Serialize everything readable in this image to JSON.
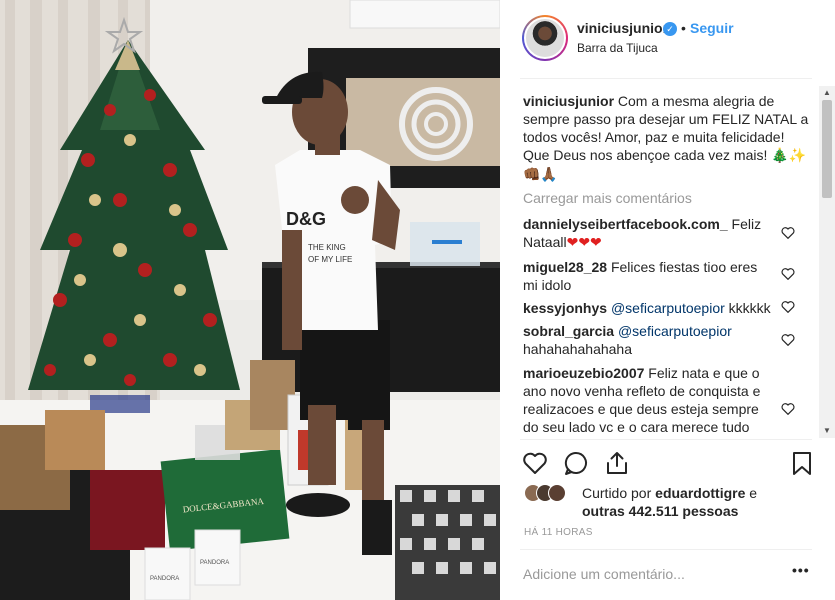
{
  "post": {
    "username": "viniciusjunior",
    "follow_label": "Seguir",
    "dot": "•",
    "location": "Barra da Tijuca"
  },
  "caption": {
    "username": "viniciusjunior",
    "text": "Com a mesma alegria de sempre passo pra desejar um FELIZ NATAL a todos vocês! Amor, paz e muita felicidade! Que Deus nos abençoe cada vez mais!",
    "emojis": "🎄✨👊🏾🙏🏾"
  },
  "load_more_label": "Carregar mais comentários",
  "comments": [
    {
      "username": "dannielyseibertfacebook.com_",
      "text": "Feliz Nataall",
      "emoji": "❤❤❤"
    },
    {
      "username": "miguel28_28",
      "text": "Felices fiestas tioo eres mi idolo",
      "emoji": ""
    },
    {
      "username": "kessyjonhys",
      "mention": "@seficarputoepior",
      "text": "kkkkkk"
    },
    {
      "username": "sobral_garcia",
      "mention": "@seficarputoepior",
      "text": "hahahahahahaha"
    },
    {
      "username": "marioeuzebio2007",
      "text": "Feliz nata e que o ano novo venha refleto de conquista e realizacoes e que deus esteja sempre do seu lado vc e o cara merece tudo"
    }
  ],
  "likes": {
    "prefix": "Curtido por",
    "user": "eduardottigre",
    "connector": "e",
    "others": "outras 442.511 pessoas"
  },
  "time": "HÁ 11 HORAS",
  "add_comment_placeholder": "Adicione um comentário...",
  "more_label": "•••",
  "photo": {
    "shirt_text_1": "D&G",
    "shirt_text_2": "THE KING",
    "shirt_text_3": "OF MY LIFE",
    "bag_brand": "DOLCE&GABBANA",
    "bag_small": "PANDORA"
  },
  "colors": {
    "link_blue": "#3897f0",
    "follow_blue": "#3897f0",
    "mention_blue": "#003569",
    "muted": "#999999",
    "text": "#262626"
  },
  "icons": [
    "heart-icon",
    "comment-icon",
    "share-icon",
    "bookmark-icon",
    "verified-badge-icon"
  ]
}
